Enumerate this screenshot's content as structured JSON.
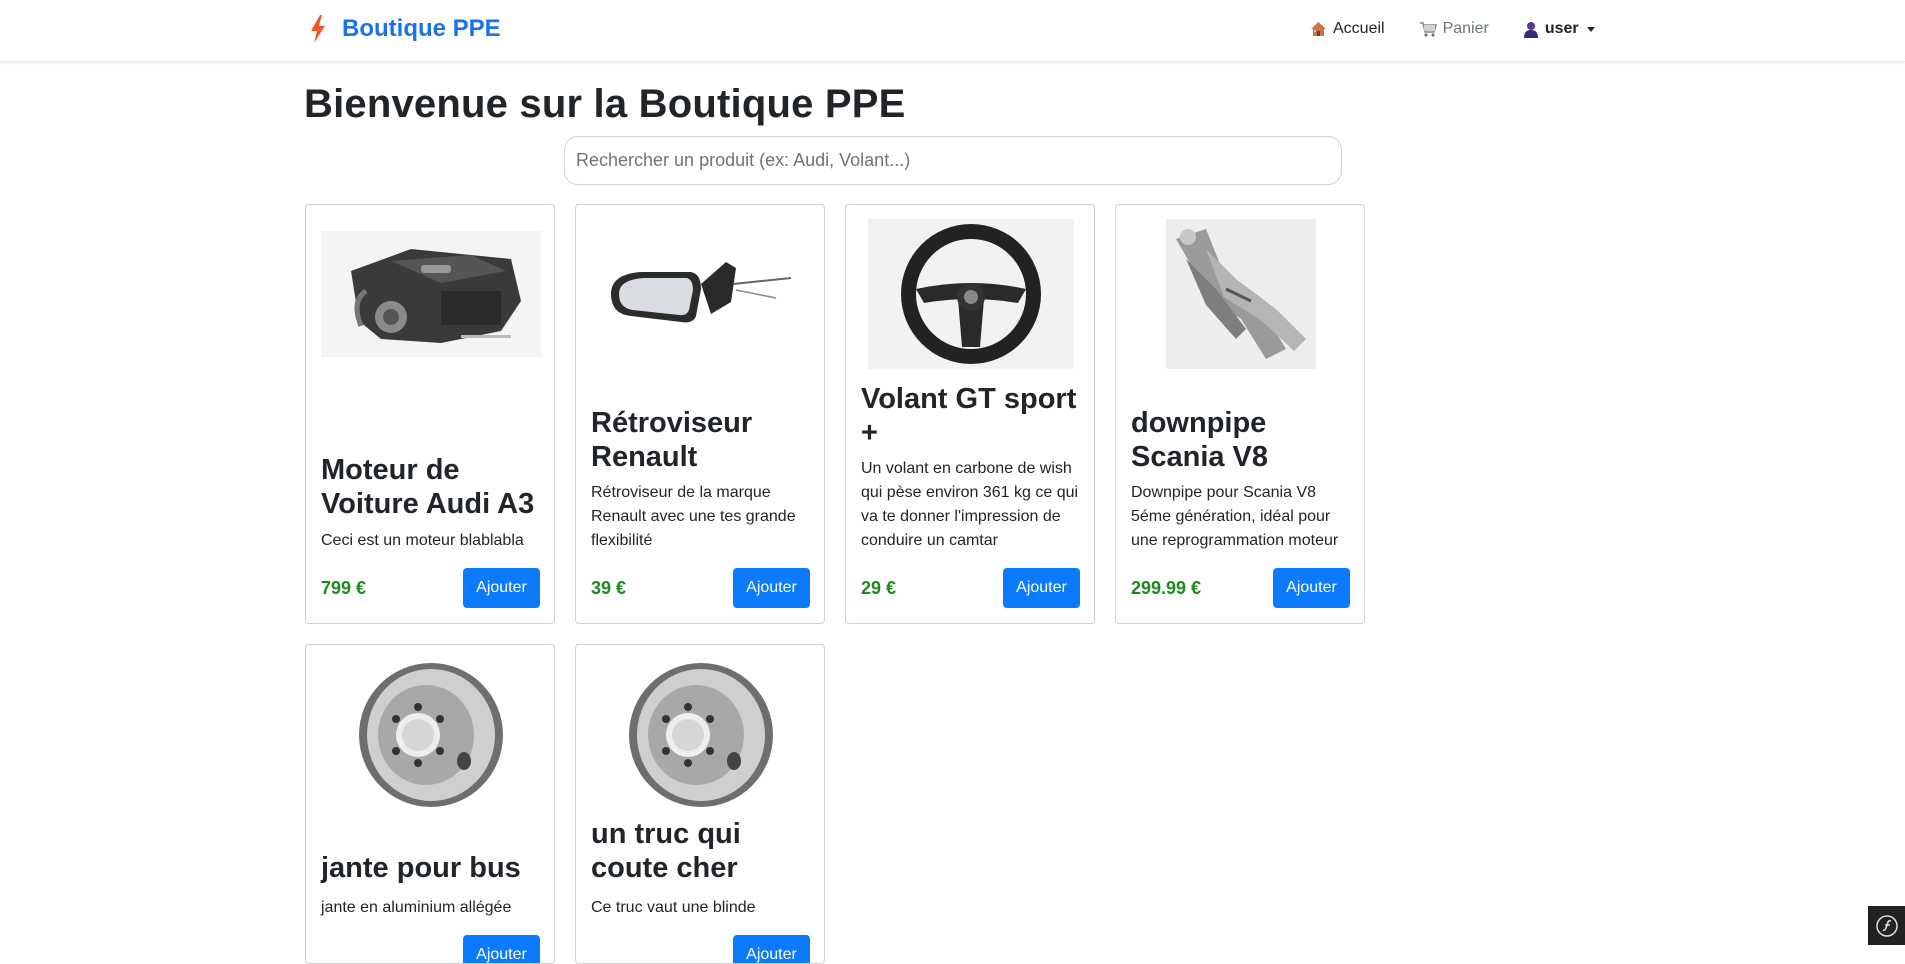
{
  "navbar": {
    "brand": "Boutique PPE",
    "links": {
      "home": "Accueil",
      "cart": "Panier",
      "user": "user"
    }
  },
  "main": {
    "title": "Bienvenue sur la Boutique PPE",
    "search_placeholder": "Rechercher un produit (ex: Audi, Volant...)"
  },
  "products": [
    {
      "name": "Moteur de Voiture Audi A3",
      "description": "Ceci est un moteur blablabla",
      "price": "799 €",
      "button": "Ajouter",
      "image": "engine"
    },
    {
      "name": "Rétroviseur Renault",
      "description": "Rétroviseur de la marque Renault avec une tes grande flexibilité",
      "price": "39 €",
      "button": "Ajouter",
      "image": "mirror"
    },
    {
      "name": "Volant GT sport +",
      "description": "Un volant en carbone de wish qui pèse environ 361 kg ce qui va te donner l'impression de conduire un camtar",
      "price": "29 €",
      "button": "Ajouter",
      "image": "steering-wheel"
    },
    {
      "name": "downpipe Scania V8",
      "description": "Downpipe pour Scania V8 5éme génération, idéal pour une reprogrammation moteur",
      "price": "299.99 €",
      "button": "Ajouter",
      "image": "downpipe"
    },
    {
      "name": "jante pour bus",
      "description": "jante en aluminium allégée",
      "price": "",
      "button": "Ajouter",
      "image": "wheel-rim"
    },
    {
      "name": "un truc qui coute cher",
      "description": "Ce truc vaut une blinde",
      "price": "",
      "button": "Ajouter",
      "image": "wheel-rim"
    }
  ],
  "colors": {
    "brand": "#1a73e8",
    "price": "#1e8a1e",
    "button": "#0b7bfb"
  }
}
